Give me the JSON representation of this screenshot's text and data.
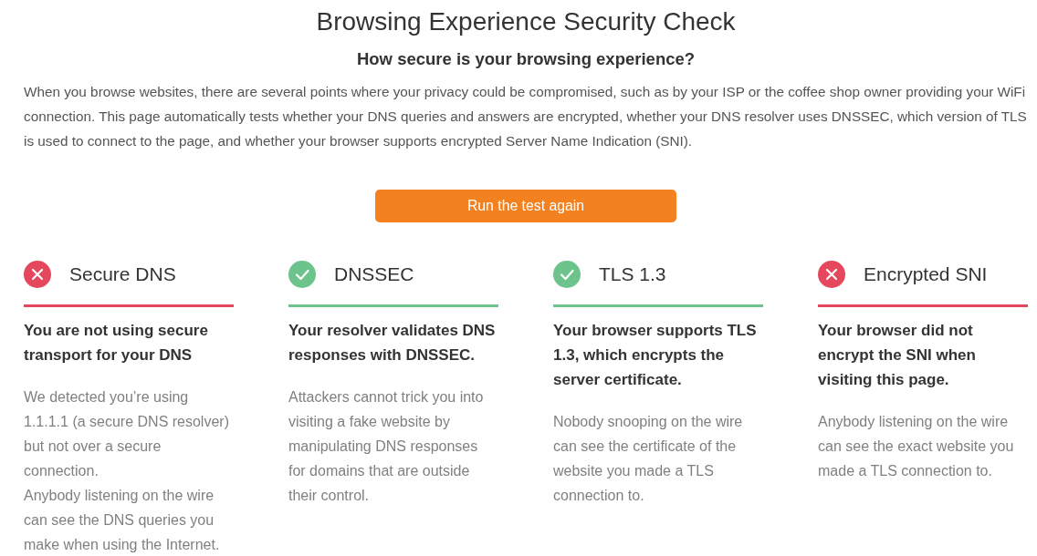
{
  "page": {
    "title": "Browsing Experience Security Check",
    "subtitle": "How secure is your browsing experience?",
    "intro": "When you browse websites, there are several points where your privacy could be compromised, such as by your ISP or the coffee shop owner providing your WiFi connection. This page automatically tests whether your DNS queries and answers are encrypted, whether your DNS resolver uses DNSSEC, which version of TLS is used to connect to the page, and whether your browser supports encrypted Server Name Indication (SNI)."
  },
  "run_button": {
    "label": "Run the test again"
  },
  "checks": [
    {
      "name": "Secure DNS",
      "passed": false,
      "summary": "You are not using secure transport for your DNS",
      "details": [
        "We detected you’re using 1.1.1.1 (a secure DNS resolver) but not over a secure connection.",
        "Anybody listening on the wire can see the DNS queries you make when using the Internet."
      ]
    },
    {
      "name": "DNSSEC",
      "passed": true,
      "summary": "Your resolver validates DNS responses with DNSSEC.",
      "details": [
        "Attackers cannot trick you into visiting a fake website by manipulating DNS responses for domains that are outside their control."
      ]
    },
    {
      "name": "TLS 1.3",
      "passed": true,
      "summary": "Your browser supports TLS 1.3, which encrypts the server certificate.",
      "details": [
        "Nobody snooping on the wire can see the certificate of the website you made a TLS connection to."
      ]
    },
    {
      "name": "Encrypted SNI",
      "passed": false,
      "summary": "Your browser did not encrypt the SNI when visiting this page.",
      "details": [
        "Anybody listening on the wire can see the exact website you made a TLS connection to."
      ]
    }
  ]
}
